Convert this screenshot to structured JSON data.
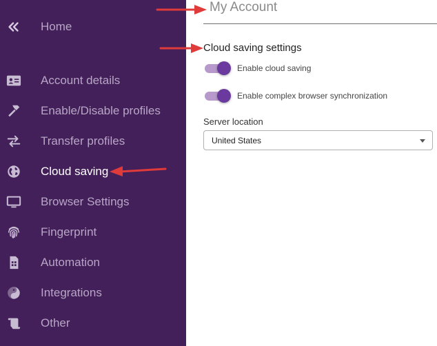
{
  "sidebar": {
    "home": {
      "label": "Home",
      "icon": "double-chevron-left-icon"
    },
    "items": [
      {
        "label": "Account details",
        "icon": "id-card-icon"
      },
      {
        "label": "Enable/Disable profiles",
        "icon": "hammer-icon"
      },
      {
        "label": "Transfer profiles",
        "icon": "transfer-arrows-icon"
      },
      {
        "label": "Cloud saving",
        "icon": "globe-icon",
        "active": true
      },
      {
        "label": "Browser Settings",
        "icon": "monitor-icon"
      },
      {
        "label": "Fingerprint",
        "icon": "fingerprint-icon"
      },
      {
        "label": "Automation",
        "icon": "sim-card-icon"
      },
      {
        "label": "Integrations",
        "icon": "yin-yang-icon"
      },
      {
        "label": "Other",
        "icon": "scroll-icon"
      }
    ],
    "background_color": "#44205a"
  },
  "main": {
    "page_title": "My Account",
    "section_title": "Cloud saving settings",
    "toggles": [
      {
        "label": "Enable cloud saving",
        "on": true
      },
      {
        "label": "Enable complex browser synchronization",
        "on": true
      }
    ],
    "server_location": {
      "label": "Server location",
      "value": "United States"
    }
  },
  "colors": {
    "accent": "#6b3a9e",
    "toggle_track": "#b79acb",
    "annotation_arrow": "#e03b3b"
  }
}
